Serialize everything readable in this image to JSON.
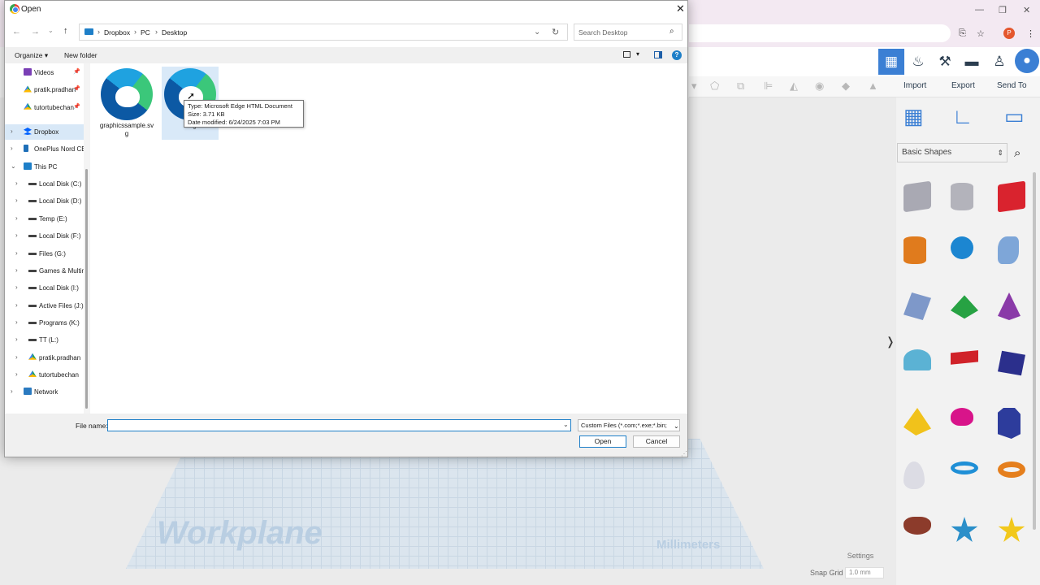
{
  "dialog": {
    "title": "Open",
    "close_glyph": "✕",
    "breadcrumb": [
      "Dropbox",
      "PC",
      "Desktop"
    ],
    "search_placeholder": "Search Desktop",
    "organize_label": "Organize",
    "new_folder_label": "New folder",
    "help_glyph": "?",
    "nav_items": [
      {
        "label": "Videos",
        "icon": "videos-icon",
        "pinned": true,
        "selected": false
      },
      {
        "label": "pratik.pradhan",
        "icon": "google-drive-icon",
        "pinned": true,
        "selected": false
      },
      {
        "label": "tutortubechan",
        "icon": "google-drive-icon",
        "pinned": true,
        "selected": false
      },
      {
        "label": "Dropbox",
        "icon": "dropbox-icon",
        "pinned": false,
        "selected": true
      },
      {
        "label": "OnePlus Nord CE",
        "icon": "phone-icon",
        "pinned": false,
        "selected": false
      },
      {
        "label": "This PC",
        "icon": "pc-icon",
        "pinned": false,
        "selected": false
      },
      {
        "label": "Local Disk (C:)",
        "icon": "drive-icon",
        "pinned": false,
        "selected": false
      },
      {
        "label": "Local Disk (D:)",
        "icon": "drive-icon",
        "pinned": false,
        "selected": false
      },
      {
        "label": "Temp (E:)",
        "icon": "drive-icon",
        "pinned": false,
        "selected": false
      },
      {
        "label": "Local Disk (F:)",
        "icon": "drive-icon",
        "pinned": false,
        "selected": false
      },
      {
        "label": "Files (G:)",
        "icon": "drive-icon",
        "pinned": false,
        "selected": false
      },
      {
        "label": "Games & Multimedia",
        "icon": "drive-icon",
        "pinned": false,
        "selected": false
      },
      {
        "label": "Local Disk (I:)",
        "icon": "drive-icon",
        "pinned": false,
        "selected": false
      },
      {
        "label": "Active Files (J:)",
        "icon": "drive-icon",
        "pinned": false,
        "selected": false
      },
      {
        "label": "Programs (K:)",
        "icon": "drive-icon",
        "pinned": false,
        "selected": false
      },
      {
        "label": "TT (L:)",
        "icon": "drive-icon",
        "pinned": false,
        "selected": false
      },
      {
        "label": "pratik.pradhan",
        "icon": "google-drive-icon",
        "pinned": false,
        "selected": false
      },
      {
        "label": "tutortubechan",
        "icon": "google-drive-icon",
        "pinned": false,
        "selected": false
      },
      {
        "label": "Network",
        "icon": "network-icon",
        "pinned": false,
        "selected": false
      }
    ],
    "files": [
      {
        "name": "graphicssample.svg",
        "icon": "edge-html-icon"
      },
      {
        "name": "s...g",
        "icon": "edge-html-icon"
      }
    ],
    "tooltip": {
      "type": "Type: Microsoft Edge HTML Document",
      "size": "Size: 3.71 KB",
      "modified": "Date modified: 6/24/2025 7:03 PM"
    },
    "file_name_label": "File name:",
    "file_name_value": "",
    "file_type": "Custom Files (*.com;*.exe;*.bin;",
    "open_label": "Open",
    "cancel_label": "Cancel"
  },
  "tinkercad": {
    "actions": {
      "import": "Import",
      "export": "Export",
      "send_to": "Send To"
    },
    "shape_category": "Basic Shapes",
    "workplane_label": "Workplane",
    "units_label": "Millimeters",
    "settings_label": "Settings",
    "snap_grid_label": "Snap Grid",
    "snap_grid_value": "1.0 mm",
    "profile_initial": "P",
    "shapes": [
      {
        "name": "box-striped",
        "color": "#a9a9b3"
      },
      {
        "name": "cylinder-striped",
        "color": "#b3b3bb"
      },
      {
        "name": "box",
        "color": "#d9232e"
      },
      {
        "name": "cylinder",
        "color": "#e07b1d"
      },
      {
        "name": "sphere",
        "color": "#1c86d1"
      },
      {
        "name": "scribble",
        "color": "#7ea6d8"
      },
      {
        "name": "text-shape",
        "color": "#7e98c9"
      },
      {
        "name": "roof",
        "color": "#27a243"
      },
      {
        "name": "cone",
        "color": "#8a3aa8"
      },
      {
        "name": "round-roof",
        "color": "#5bb2d4"
      },
      {
        "name": "text",
        "color": "#d02229"
      },
      {
        "name": "polygon",
        "color": "#2b2f8c"
      },
      {
        "name": "pyramid",
        "color": "#f1c21b"
      },
      {
        "name": "half-sphere",
        "color": "#d8148a"
      },
      {
        "name": "hexagonal-prism",
        "color": "#2d3c9c"
      },
      {
        "name": "paraboloid",
        "color": "#dcdce4"
      },
      {
        "name": "torus",
        "color": "#1f8fd6"
      },
      {
        "name": "tube",
        "color": "#e57f1d"
      },
      {
        "name": "heart",
        "color": "#8c3b2b"
      },
      {
        "name": "star-blue",
        "color": "#2b8fc9"
      },
      {
        "name": "star-yellow",
        "color": "#f2c81c"
      }
    ]
  },
  "colors": {
    "accent": "#1e7fc8",
    "tinkercad_blue": "#3b7fd4"
  }
}
